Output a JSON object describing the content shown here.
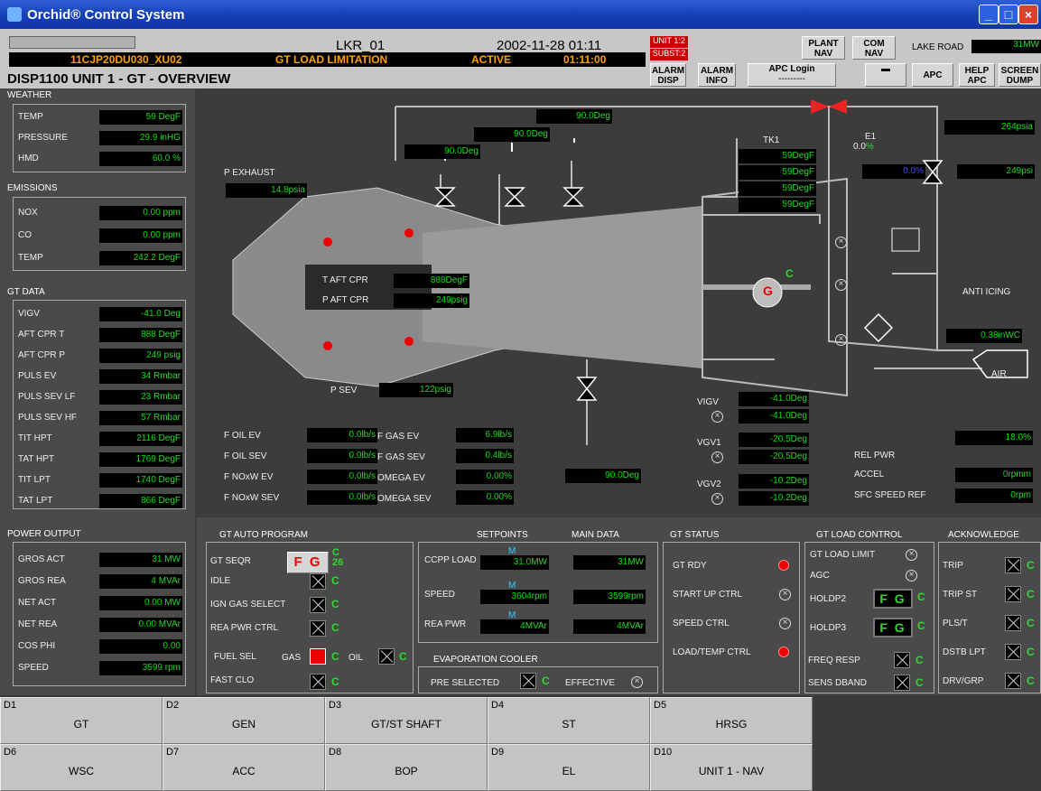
{
  "window": {
    "title": "Orchid® Control System"
  },
  "header": {
    "sys": "LKR_01",
    "datetime": "2002-11-28 01:11",
    "tag": "11CJP20DU030_XU02",
    "message": "GT LOAD LIMITATION",
    "state": "ACTIVE",
    "time": "01:11:00",
    "unit_badge": "UNIT 1:2",
    "subst_badge": "SUBST:2",
    "page_title": "DISP1100 UNIT 1 - GT - OVERVIEW",
    "alarm_disp": "ALARM DISP",
    "alarm_info": "ALARM INFO",
    "apc_login": "APC Login",
    "apc_login_sub": "---------",
    "plant_nav": "PLANT NAV",
    "com_nav": "COM NAV",
    "location": "LAKE ROAD",
    "location_val": "31",
    "location_unit": "MW",
    "apc": "APC",
    "help_apc": "HELP APC",
    "screen_dump": "SCREEN DUMP"
  },
  "weather": {
    "title": "WEATHER",
    "rows": [
      {
        "label": "TEMP",
        "value": "59",
        "unit": "DegF"
      },
      {
        "label": "PRESSURE",
        "value": "29.9",
        "unit": "inHG"
      },
      {
        "label": "HMD",
        "value": "60.0",
        "unit": "%"
      }
    ]
  },
  "emissions": {
    "title": "EMISSIONS",
    "rows": [
      {
        "label": "NOX",
        "value": "0.00",
        "unit": "ppm"
      },
      {
        "label": "CO",
        "value": "0.00",
        "unit": "ppm"
      },
      {
        "label": "TEMP",
        "value": "242.2",
        "unit": "DegF"
      }
    ]
  },
  "gtdata": {
    "title": "GT DATA",
    "rows": [
      {
        "label": "VIGV",
        "value": "-41.0",
        "unit": "Deg"
      },
      {
        "label": "AFT CPR T",
        "value": "888",
        "unit": "DegF"
      },
      {
        "label": "AFT CPR P",
        "value": "249",
        "unit": "psig"
      },
      {
        "label": "PULS EV",
        "value": "34",
        "unit": "Rmbar"
      },
      {
        "label": "PULS SEV LF",
        "value": "23",
        "unit": "Rmbar"
      },
      {
        "label": "PULS SEV HF",
        "value": "57",
        "unit": "Rmbar"
      },
      {
        "label": "TIT HPT",
        "value": "2116",
        "unit": "DegF"
      },
      {
        "label": "TAT HPT",
        "value": "1769",
        "unit": "DegF"
      },
      {
        "label": "TIT LPT",
        "value": "1740",
        "unit": "DegF"
      },
      {
        "label": "TAT LPT",
        "value": "866",
        "unit": "DegF"
      }
    ]
  },
  "power": {
    "title": "POWER OUTPUT",
    "rows": [
      {
        "label": "GROS ACT",
        "value": "31",
        "unit": "MW"
      },
      {
        "label": "GROS REA",
        "value": "4",
        "unit": "MVAr"
      },
      {
        "label": "NET ACT",
        "value": "0.00",
        "unit": "MW"
      },
      {
        "label": "NET REA",
        "value": "0.00",
        "unit": "MVAr"
      },
      {
        "label": "COS PHI",
        "value": "0.00",
        "unit": ""
      },
      {
        "label": "SPEED",
        "value": "3599",
        "unit": "rpm"
      }
    ]
  },
  "diagram": {
    "p_exhaust": {
      "label": "P EXHAUST",
      "value": "14.8",
      "unit": "psia"
    },
    "valve_a": {
      "value": "90.0",
      "unit": "Deg"
    },
    "valve_b": {
      "value": "90.0",
      "unit": "Deg"
    },
    "valve_c": {
      "value": "90.0",
      "unit": "Deg"
    },
    "valve_d": {
      "value": "90.0",
      "unit": "Deg"
    },
    "tk1": {
      "label": "TK1",
      "values": [
        "59",
        "59",
        "59",
        "59"
      ],
      "unit": "DegF"
    },
    "e1": {
      "label": "E1",
      "value": "0.0",
      "unit": "%"
    },
    "blue_val": {
      "value": "0.0",
      "unit": "%"
    },
    "psia264": {
      "value": "264",
      "unit": "psia"
    },
    "psi249": {
      "value": "249",
      "unit": "psi"
    },
    "t_aft": {
      "label": "T AFT CPR",
      "value": "888",
      "unit": "DegF"
    },
    "p_aft": {
      "label": "P AFT CPR",
      "value": "249",
      "unit": "psig"
    },
    "gen": "G",
    "gen_c": "C",
    "anti_icing": "ANTI ICING",
    "inwc": {
      "value": "0.38",
      "unit": "inWC"
    },
    "air": "AIR",
    "p_sev": {
      "label": "P SEV",
      "value": "122",
      "unit": "psig"
    },
    "vigv": {
      "label": "VIGV",
      "v1": "-41.0",
      "v2": "-41.0",
      "unit": "Deg"
    },
    "vgv1": {
      "label": "VGV1",
      "v1": "-20.5",
      "v2": "-20.5",
      "unit": "Deg"
    },
    "vgv2": {
      "label": "VGV2",
      "v1": "-10.2",
      "v2": "-10.2",
      "unit": "Deg"
    },
    "flows": [
      {
        "label": "F OIL EV",
        "value": "0.0",
        "unit": "lb/s"
      },
      {
        "label": "F OIL SEV",
        "value": "0.0",
        "unit": "lb/s"
      },
      {
        "label": "F NOxW EV",
        "value": "0.0",
        "unit": "lb/s"
      },
      {
        "label": "F NOxW SEV",
        "value": "0.0",
        "unit": "lb/s"
      }
    ],
    "flows2": [
      {
        "label": "F GAS EV",
        "value": "6.9",
        "unit": "lb/s"
      },
      {
        "label": "F GAS SEV",
        "value": "0.4",
        "unit": "lb/s"
      },
      {
        "label": "OMEGA EV",
        "value": "0.00",
        "unit": "%"
      },
      {
        "label": "OMEGA SEV",
        "value": "0.00",
        "unit": "%"
      }
    ],
    "rel_pwr": {
      "label": "REL PWR",
      "value": "18.0",
      "unit": "%"
    },
    "accel": {
      "label": "ACCEL",
      "value": "0",
      "unit": "rpmm"
    },
    "sfc": {
      "label": "SFC SPEED REF",
      "value": "0",
      "unit": "rpm"
    }
  },
  "auto": {
    "title": "GT AUTO PROGRAM",
    "seqr": "GT SEQR",
    "fg": "F G",
    "c26": "C 26",
    "rows": [
      "IDLE",
      "IGN GAS SELECT",
      "REA PWR CTRL"
    ],
    "fuel": "FUEL SEL",
    "gas": "GAS",
    "oil": "OIL",
    "fastclo": "FAST CLO",
    "c": "C"
  },
  "setp": {
    "title": "SETPOINTS",
    "main": "MAIN DATA",
    "m": "M",
    "ccpp": "CCPP LOAD",
    "ccpp_sp": "31.0",
    "ccpp_u": "MW",
    "ccpp_main": "31",
    "speed": "SPEED",
    "speed_sp": "3604",
    "speed_u": "rpm",
    "speed_main": "3599",
    "reapwr": "REA PWR",
    "rea_sp": "4",
    "rea_u": "MVAr",
    "rea_main": "4"
  },
  "evap": {
    "title": "EVAPORATION COOLER",
    "pre": "PRE SELECTED",
    "eff": "EFFECTIVE"
  },
  "status": {
    "title": "GT STATUS",
    "rows": [
      "GT RDY",
      "START UP CTRL",
      "SPEED CTRL",
      "LOAD/TEMP CTRL"
    ]
  },
  "loadctl": {
    "title": "GT LOAD CONTROL",
    "limit": "GT LOAD LIMIT",
    "agc": "AGC",
    "holdp2": "HOLDP2",
    "holdp3": "HOLDP3",
    "freq": "FREQ RESP",
    "sens": "SENS DBAND",
    "fg": "F G"
  },
  "ack": {
    "title": "ACKNOWLEDGE",
    "rows": [
      "TRIP",
      "TRIP ST",
      "PLS/T",
      "DSTB LPT",
      "DRV/GRP"
    ]
  },
  "nav": [
    {
      "k": "D1",
      "t": "GT"
    },
    {
      "k": "D2",
      "t": "GEN"
    },
    {
      "k": "D3",
      "t": "GT/ST SHAFT"
    },
    {
      "k": "D4",
      "t": "ST"
    },
    {
      "k": "D5",
      "t": "HRSG"
    },
    {
      "k": "D6",
      "t": "WSC"
    },
    {
      "k": "D7",
      "t": "ACC"
    },
    {
      "k": "D8",
      "t": "BOP"
    },
    {
      "k": "D9",
      "t": "EL"
    },
    {
      "k": "D10",
      "t": "UNIT 1 - NAV"
    }
  ]
}
